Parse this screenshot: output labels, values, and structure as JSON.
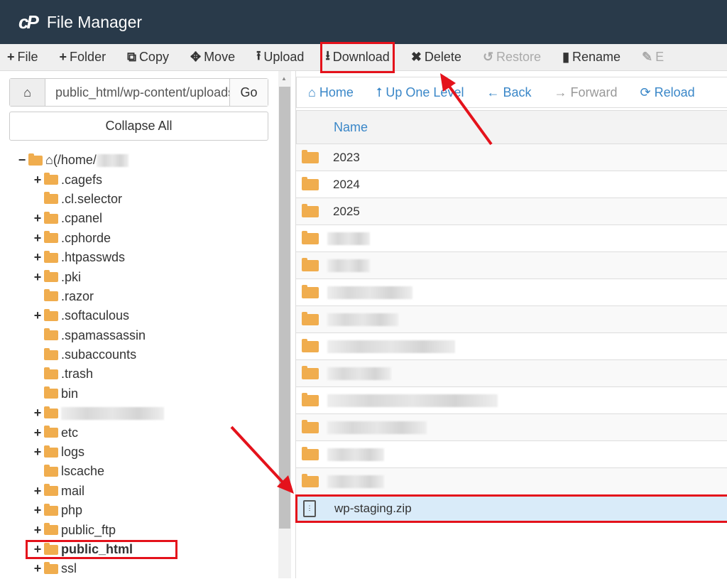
{
  "header": {
    "logo": "cP",
    "title": "File Manager"
  },
  "toolbar": [
    {
      "icon": "plus-icon",
      "glyph": "+",
      "label": "File",
      "disabled": false
    },
    {
      "icon": "plus-icon",
      "glyph": "+",
      "label": "Folder",
      "disabled": false
    },
    {
      "icon": "copy-icon",
      "glyph": "⧉",
      "label": "Copy",
      "disabled": false
    },
    {
      "icon": "move-icon",
      "glyph": "✥",
      "label": "Move",
      "disabled": false
    },
    {
      "icon": "upload-icon",
      "glyph": "⭱",
      "label": "Upload",
      "disabled": false
    },
    {
      "icon": "download-icon",
      "glyph": "⭳",
      "label": "Download",
      "disabled": false,
      "highlighted": true
    },
    {
      "icon": "delete-icon",
      "glyph": "✖",
      "label": "Delete",
      "disabled": false
    },
    {
      "icon": "restore-icon",
      "glyph": "↺",
      "label": "Restore",
      "disabled": true
    },
    {
      "icon": "rename-icon",
      "glyph": "▮",
      "label": "Rename",
      "disabled": false
    },
    {
      "icon": "edit-icon",
      "glyph": "✎",
      "label": "E",
      "disabled": true
    }
  ],
  "left": {
    "path_value": "public_html/wp-content/uploads",
    "go": "Go",
    "collapse_all": "Collapse All",
    "tree": [
      {
        "toggle": "−",
        "label": "(/home/",
        "root": true,
        "blurred_suffix": true
      },
      {
        "toggle": "+",
        "label": ".cagefs"
      },
      {
        "toggle": "",
        "label": ".cl.selector"
      },
      {
        "toggle": "+",
        "label": ".cpanel"
      },
      {
        "toggle": "+",
        "label": ".cphorde"
      },
      {
        "toggle": "+",
        "label": ".htpasswds"
      },
      {
        "toggle": "+",
        "label": ".pki"
      },
      {
        "toggle": "",
        "label": ".razor"
      },
      {
        "toggle": "+",
        "label": ".softaculous"
      },
      {
        "toggle": "",
        "label": ".spamassassin"
      },
      {
        "toggle": "",
        "label": ".subaccounts"
      },
      {
        "toggle": "",
        "label": ".trash"
      },
      {
        "toggle": "",
        "label": "bin"
      },
      {
        "toggle": "+",
        "label": "",
        "blurred": true
      },
      {
        "toggle": "+",
        "label": "etc"
      },
      {
        "toggle": "+",
        "label": "logs"
      },
      {
        "toggle": "",
        "label": "lscache"
      },
      {
        "toggle": "+",
        "label": "mail"
      },
      {
        "toggle": "+",
        "label": "php"
      },
      {
        "toggle": "+",
        "label": "public_ftp"
      },
      {
        "toggle": "+",
        "label": "public_html",
        "bold": true,
        "highlighted": true
      },
      {
        "toggle": "+",
        "label": "ssl"
      }
    ]
  },
  "nav": [
    {
      "icon": "home-icon",
      "glyph": "⌂",
      "label": "Home",
      "disabled": false
    },
    {
      "icon": "up-level-icon",
      "glyph": "⭡",
      "label": "Up One Level",
      "disabled": false
    },
    {
      "icon": "back-icon",
      "glyph": "←",
      "label": "Back",
      "disabled": false
    },
    {
      "icon": "forward-icon",
      "glyph": "→",
      "label": "Forward",
      "disabled": true
    },
    {
      "icon": "reload-icon",
      "glyph": "⟳",
      "label": "Reload",
      "disabled": false
    }
  ],
  "table": {
    "column": "Name",
    "rows": [
      {
        "name": "2023",
        "type": "folder"
      },
      {
        "name": "2024",
        "type": "folder"
      },
      {
        "name": "2025",
        "type": "folder"
      },
      {
        "name": "",
        "type": "folder",
        "blurred": true
      },
      {
        "name": "",
        "type": "folder",
        "blurred": true
      },
      {
        "name": "",
        "type": "folder",
        "blurred": true
      },
      {
        "name": "",
        "type": "folder",
        "blurred": true
      },
      {
        "name": "",
        "type": "folder",
        "blurred": true
      },
      {
        "name": "",
        "type": "folder",
        "blurred": true
      },
      {
        "name": "",
        "type": "folder",
        "blurred": true
      },
      {
        "name": "",
        "type": "folder",
        "blurred": true
      },
      {
        "name": "",
        "type": "folder",
        "blurred": true
      },
      {
        "name": "",
        "type": "folder",
        "blurred": true
      },
      {
        "name": "wp-staging.zip",
        "type": "zip",
        "selected": true
      }
    ]
  },
  "colors": {
    "header": "#293a4a",
    "accent": "#3a87c8",
    "folder": "#f0ad4e",
    "highlight": "#e4121b",
    "selected_row": "#d9ebf9"
  }
}
